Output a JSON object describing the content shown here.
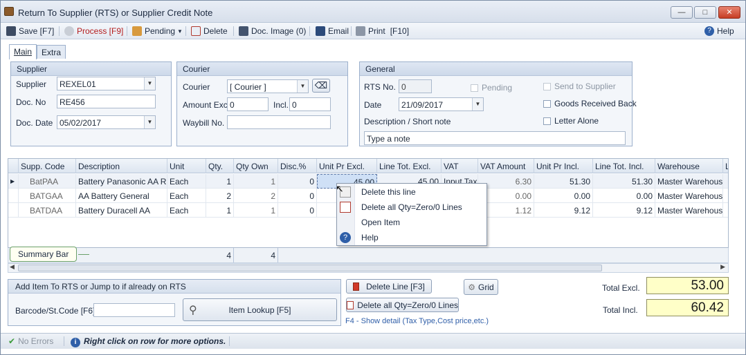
{
  "window": {
    "title": "Return To Supplier (RTS) or Supplier Credit Note"
  },
  "toolbar": {
    "save": "Save [F7]",
    "process": "Process [F9]",
    "pending": "Pending",
    "delete": "Delete",
    "doc_image": "Doc. Image (0)",
    "email": "Email",
    "print": "Print",
    "print_key": "[F10]",
    "help": "Help"
  },
  "tabs": [
    {
      "label": "Main"
    },
    {
      "label": "Extra"
    }
  ],
  "supplier": {
    "header": "Supplier",
    "supplier_label": "Supplier",
    "supplier_value": "REXEL01",
    "docno_label": "Doc. No",
    "docno_value": "RE456",
    "docdate_label": "Doc. Date",
    "docdate_value": "05/02/2017"
  },
  "courier": {
    "header": "Courier",
    "courier_label": "Courier",
    "courier_value": "[ Courier ]",
    "amount_label": "Amount Excl.",
    "amount_value": "0",
    "incl_label": "Incl.",
    "incl_value": "0",
    "waybill_label": "Waybill No.",
    "waybill_value": ""
  },
  "general": {
    "header": "General",
    "rtsno_label": "RTS No.",
    "rtsno_value": "0",
    "pending": "Pending",
    "send_to_supplier": "Send to Supplier",
    "date_label": "Date",
    "date_value": "21/09/2017",
    "goods_received_back": "Goods Received Back",
    "desc_label": "Description / Short note",
    "letter_alone": "Letter Alone",
    "note_value": "Type a note"
  },
  "grid": {
    "headers": [
      "Supp. Code",
      "Description",
      "Unit",
      "Qty.",
      "Qty Own",
      "Disc.%",
      "Unit Pr Excl.",
      "Line Tot. Excl.",
      "VAT",
      "VAT Amount",
      "Unit Pr Incl.",
      "Line Tot. Incl.",
      "Warehouse",
      "L"
    ],
    "rows": [
      [
        "BatPAA",
        "Battery Panasonic AA R...",
        "Each",
        "1",
        "1",
        "0",
        "45.00",
        "45.00",
        "Input Tax",
        "6.30",
        "51.30",
        "51.30",
        "Master Warehouse"
      ],
      [
        "BATGAA",
        "AA Battery General",
        "Each",
        "2",
        "2",
        "0",
        "",
        "",
        "",
        "0.00",
        "0.00",
        "0.00",
        "Master Warehouse"
      ],
      [
        "BATDAA",
        "Battery Duracell AA",
        "Each",
        "1",
        "1",
        "0",
        "",
        "",
        "",
        "1.12",
        "9.12",
        "9.12",
        "Master Warehouse"
      ]
    ]
  },
  "summary": {
    "label": "Summary Bar",
    "qty_total": "4",
    "qtyown_total": "4"
  },
  "context_menu": {
    "items": [
      "Delete this line",
      "Delete all Qty=Zero/0 Lines",
      "Open Item",
      "Help"
    ]
  },
  "add_item": {
    "header": "Add Item To RTS or Jump to if already on RTS",
    "barcode_label": "Barcode/St.Code [F6]",
    "barcode_value": "",
    "lookup": "Item Lookup [F5]"
  },
  "actions": {
    "delete_line": "Delete Line [F3]",
    "delete_zero": "Delete all Qty=Zero/0 Lines",
    "grid": "Grid",
    "hint": "F4 - Show detail (Tax Type,Cost price,etc.)"
  },
  "totals": {
    "excl_label": "Total Excl.",
    "excl_value": "53.00",
    "incl_label": "Total Incl.",
    "incl_value": "60.42"
  },
  "status": {
    "errors": "No Errors",
    "tip": "Right click on row for more options."
  }
}
